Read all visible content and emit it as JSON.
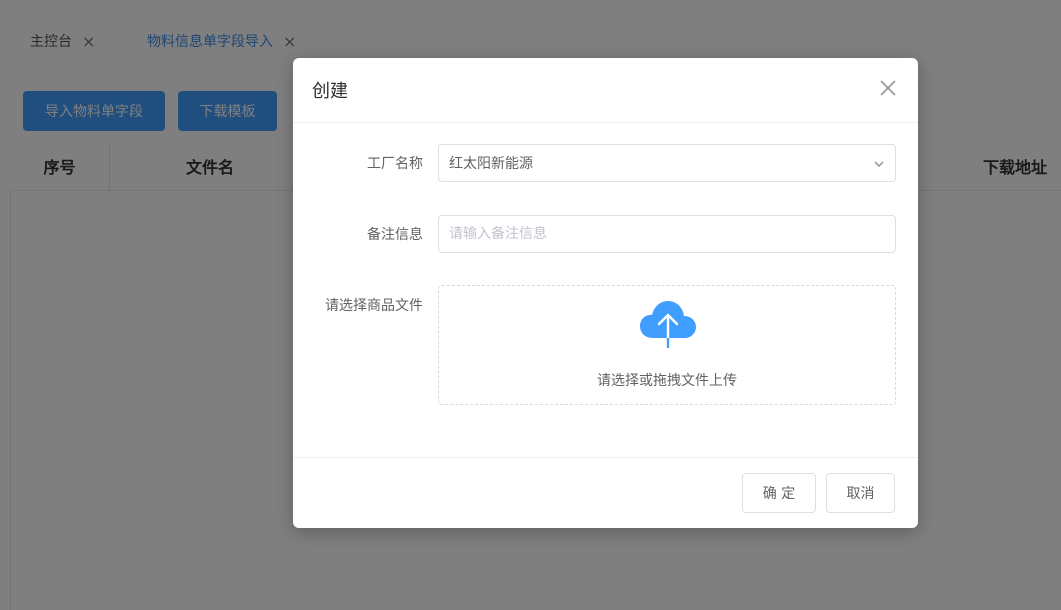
{
  "tabs": [
    {
      "label": "主控台"
    },
    {
      "label": "物料信息单字段导入"
    }
  ],
  "toolbar": {
    "import_label": "导入物料单字段",
    "download_label": "下载模板"
  },
  "table": {
    "columns": [
      "序号",
      "文件名",
      "下载地址"
    ]
  },
  "dialog": {
    "title": "创建",
    "factory": {
      "label": "工厂名称",
      "value": "红太阳新能源"
    },
    "remark": {
      "label": "备注信息",
      "placeholder": "请输入备注信息"
    },
    "file": {
      "label": "请选择商品文件",
      "hint": "请选择或拖拽文件上传"
    },
    "ok_label": "确 定",
    "cancel_label": "取消"
  },
  "colors": {
    "accent": "#409eff",
    "overlay": "rgba(0,0,0,0.5)"
  }
}
